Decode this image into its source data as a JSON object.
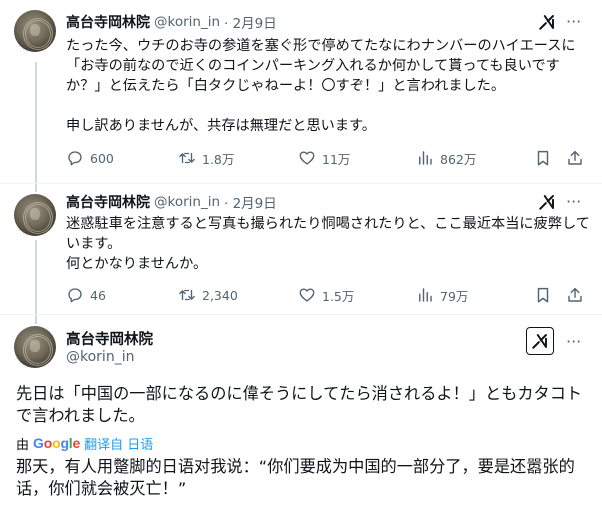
{
  "tweets": [
    {
      "name": "高台寺岡林院",
      "handle": "@korin_in",
      "date": "· 2月9日",
      "text": "たった今、ウチのお寺の参道を塞ぐ形で停めてたなにわナンバーのハイエースに「お寺の前なので近くのコインパーキング入れるか何かして貰っても良いですか？」と伝えたら「白タクじゃねーよ！〇すぞ！」と言われました。\n\n申し訳ありませんが、共存は無理だと思います。",
      "replies": "600",
      "reposts": "1.8万",
      "likes": "11万",
      "views": "862万"
    },
    {
      "name": "高台寺岡林院",
      "handle": "@korin_in",
      "date": "· 2月9日",
      "text": "迷惑駐車を注意すると写真も撮られたり恫喝されたりと、ここ最近本当に疲弊しています。\n何とかなりませんか。",
      "replies": "46",
      "reposts": "2,340",
      "likes": "1.5万",
      "views": "79万"
    }
  ],
  "main": {
    "name": "高台寺岡林院",
    "handle": "@korin_in",
    "text": "先日は「中国の一部になるのに偉そうにしてたら消されるよ！」ともカタコトで言われました。",
    "translate_by": "由",
    "google_letters": [
      "G",
      "o",
      "o",
      "g",
      "l",
      "e"
    ],
    "translate_link": "翻译自 日语",
    "translated_text": "那天，有人用蹩脚的日语对我说：“你们要成为中国的一部分了，要是还嚣张的话，你们就会被灭亡！”"
  },
  "icons": {
    "reply": "reply-icon",
    "repost": "repost-icon",
    "like": "heart-icon",
    "views": "views-icon",
    "bookmark": "bookmark-icon",
    "share": "share-icon",
    "grok": "grok-icon",
    "more": "more-icon"
  },
  "colors": {
    "text": "#0f1419",
    "secondary": "#536471",
    "link": "#1d9bf0",
    "divider": "#eff3f4",
    "thread_line": "#cfd9de",
    "google_blue": "#4285F4",
    "google_red": "#EA4335",
    "google_yellow": "#FBBC05",
    "google_green": "#34A853"
  }
}
